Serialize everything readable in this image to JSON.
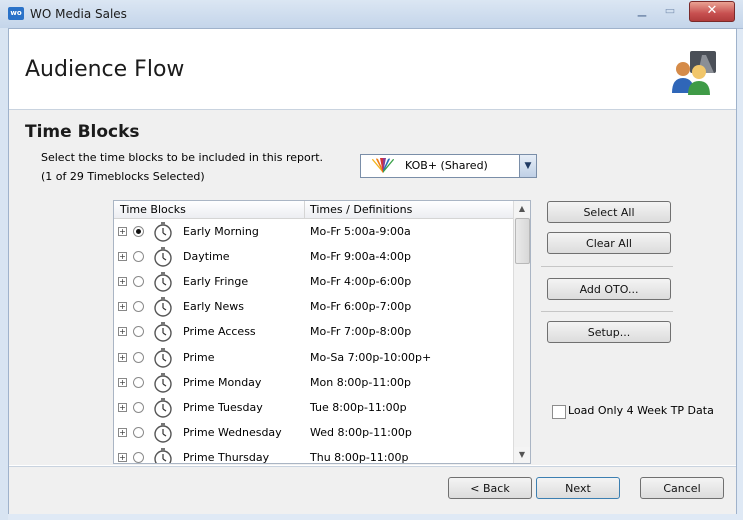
{
  "window": {
    "app_icon_text": "wo",
    "title": "WO Media Sales",
    "close_glyph": "✕"
  },
  "header": {
    "title": "Audience Flow"
  },
  "section": {
    "title": "Time Blocks",
    "instruction": "Select the time blocks to be included in this report.",
    "selection_count": "(1 of 29 Timeblocks Selected)"
  },
  "station": {
    "label": "KOB+ (Shared)",
    "icon": "nbc-peacock-icon"
  },
  "list": {
    "columns": [
      "Time Blocks",
      "Times / Definitions"
    ],
    "rows": [
      {
        "name": "Early Morning",
        "time": "Mo-Fr 5:00a-9:00a",
        "selected": true
      },
      {
        "name": "Daytime",
        "time": "Mo-Fr 9:00a-4:00p",
        "selected": false
      },
      {
        "name": "Early Fringe",
        "time": "Mo-Fr 4:00p-6:00p",
        "selected": false
      },
      {
        "name": "Early News",
        "time": "Mo-Fr 6:00p-7:00p",
        "selected": false
      },
      {
        "name": "Prime Access",
        "time": "Mo-Fr 7:00p-8:00p",
        "selected": false
      },
      {
        "name": "Prime",
        "time": "Mo-Sa 7:00p-10:00p+",
        "selected": false
      },
      {
        "name": "Prime Monday",
        "time": "Mon 8:00p-11:00p",
        "selected": false
      },
      {
        "name": "Prime Tuesday",
        "time": "Tue 8:00p-11:00p",
        "selected": false
      },
      {
        "name": "Prime Wednesday",
        "time": "Wed 8:00p-11:00p",
        "selected": false
      },
      {
        "name": "Prime Thursday",
        "time": "Thu 8:00p-11:00p",
        "selected": false
      }
    ]
  },
  "actions": {
    "select_all": "Select All",
    "clear_all": "Clear All",
    "add_oto": "Add OTO...",
    "setup": "Setup...",
    "load_only_label": "Load Only 4 Week TP Data"
  },
  "footer": {
    "back": "< Back",
    "next": "Next",
    "cancel": "Cancel"
  }
}
